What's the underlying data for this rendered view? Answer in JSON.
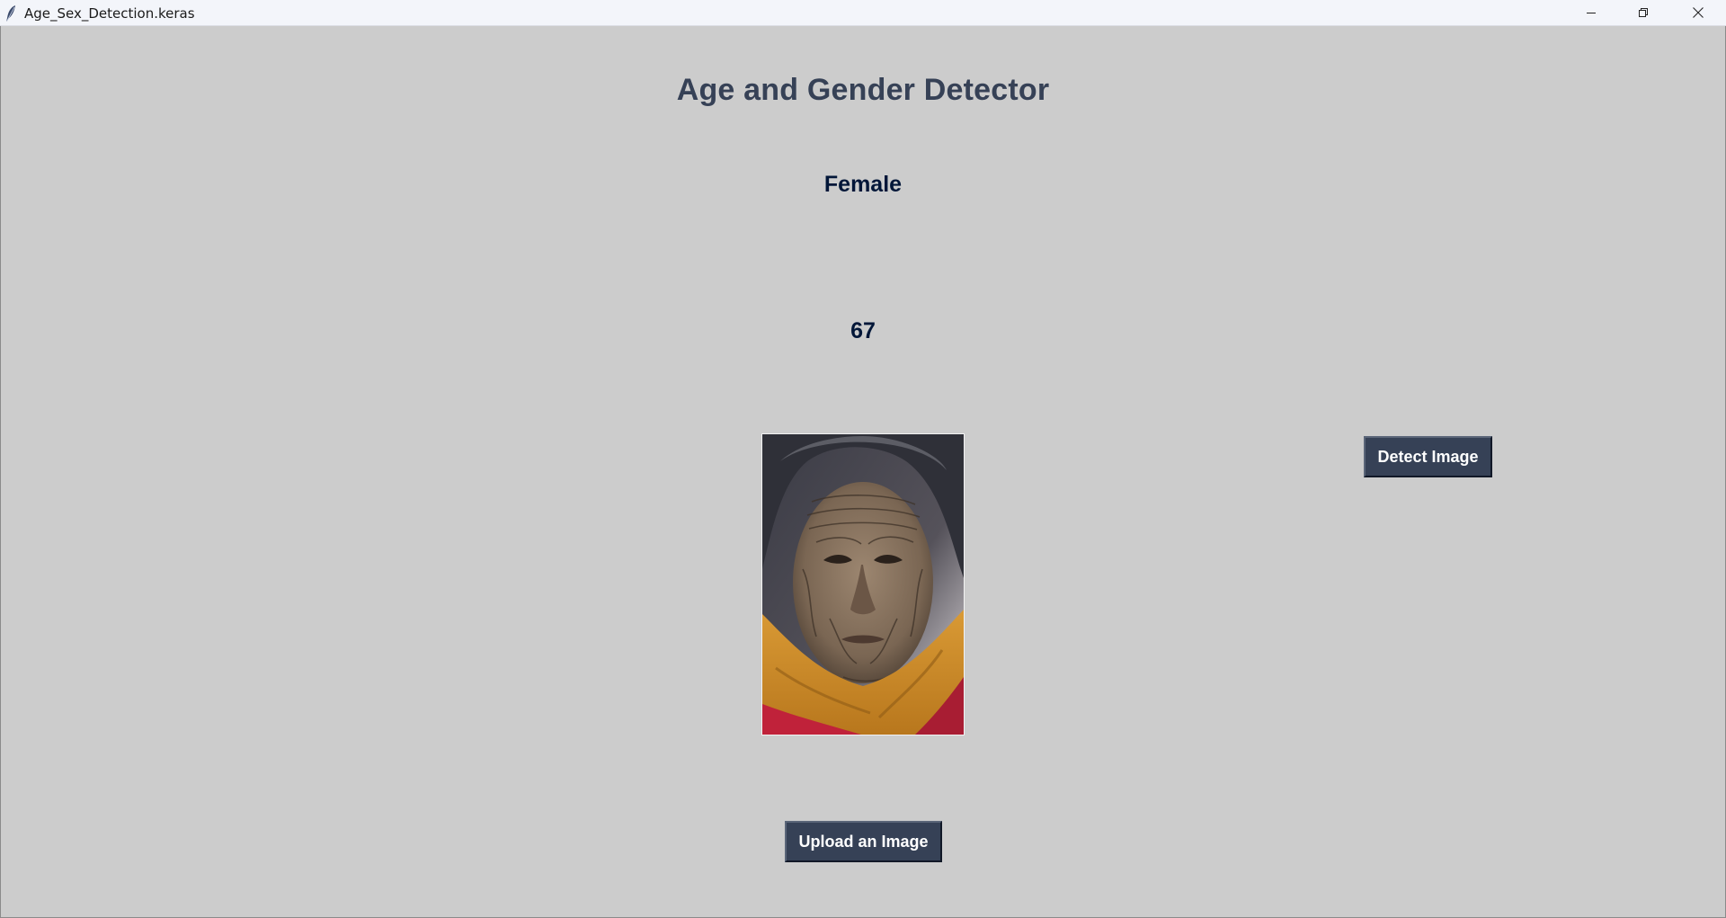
{
  "window": {
    "title": "Age_Sex_Detection.keras",
    "icons": {
      "app": "feather-icon",
      "minimize": "minimize-icon",
      "maximize": "restore-icon",
      "close": "close-icon"
    }
  },
  "app": {
    "heading": "Age and Gender Detector",
    "gender": "Female",
    "age": "67",
    "detect_button": "Detect Image",
    "upload_button": "Upload an Image",
    "colors": {
      "background": "#cccccc",
      "heading": "#364156",
      "result_text": "#011638",
      "button_bg": "#364156",
      "button_text": "#ffffff"
    }
  }
}
